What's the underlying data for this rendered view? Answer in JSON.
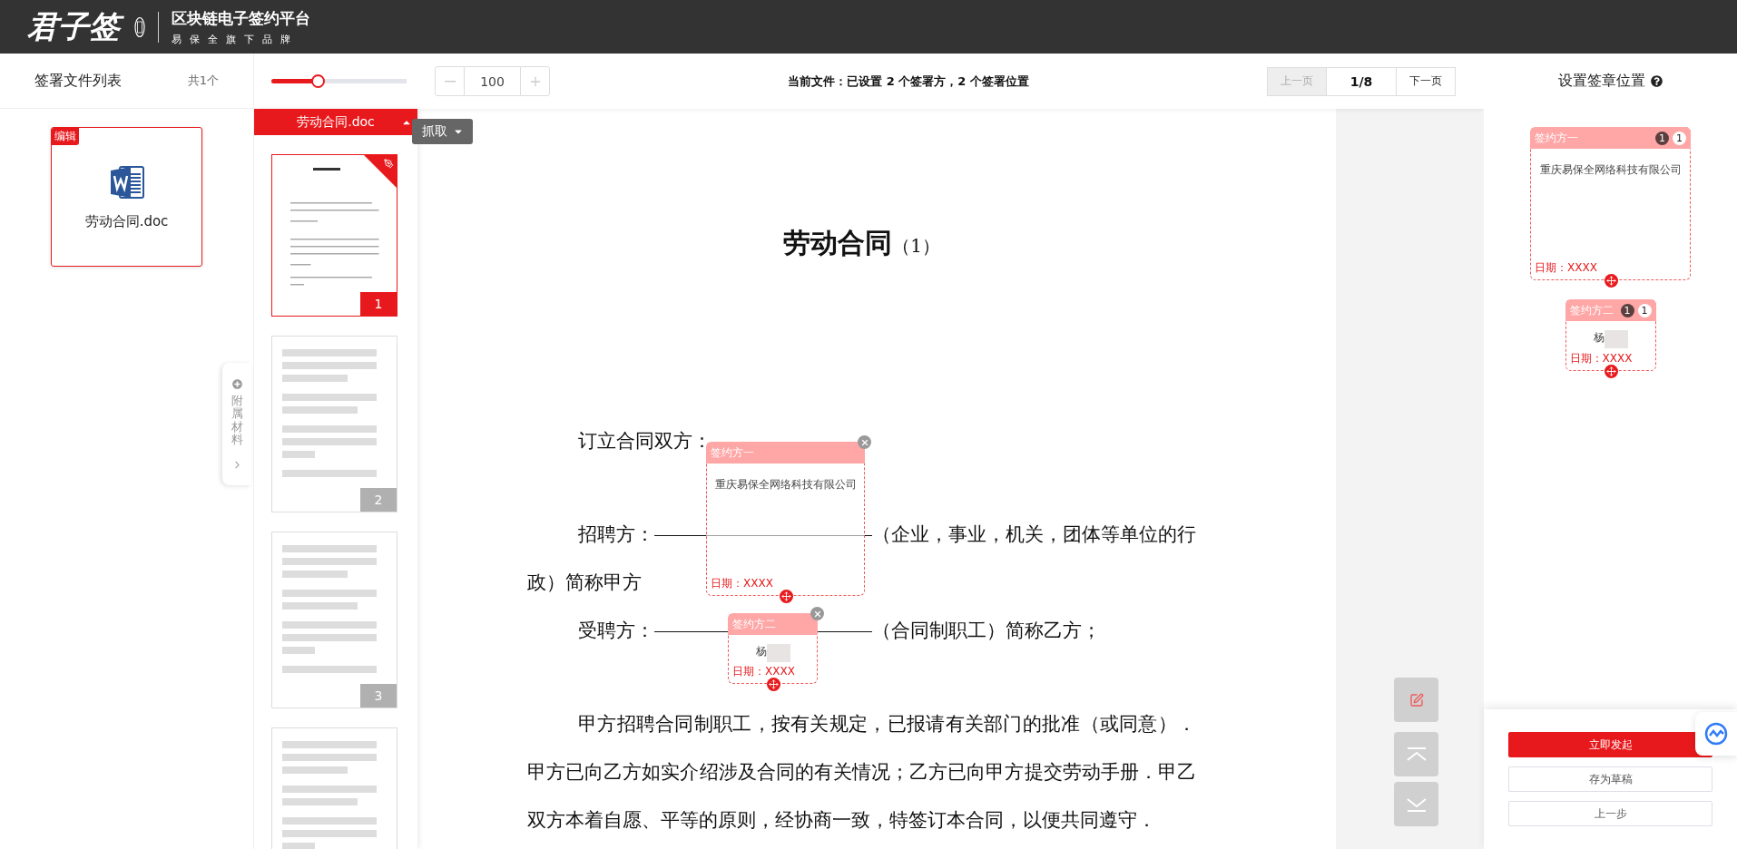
{
  "header": {
    "logo_text": "君子签",
    "platform": "区块链电子签约平台",
    "tagline": "易保全旗下品牌"
  },
  "file_list": {
    "title": "签署文件列表",
    "count": "共1个",
    "files": [
      {
        "name": "劳动合同.doc",
        "badge": "编辑",
        "selected": true
      }
    ]
  },
  "toolbar": {
    "zoom": {
      "level": 0.33,
      "value": "100"
    },
    "status": "当前文件：已设置 2 个签署方，2 个签署位置",
    "pager": {
      "prev": {
        "label": "上一页",
        "disabled": true
      },
      "page": "1/8",
      "next": {
        "label": "下一页",
        "disabled": false
      }
    }
  },
  "thumbnails": {
    "file_name": "劳动合同.doc",
    "grab_button": "抓取",
    "pages": [
      {
        "number": "1",
        "selected": true,
        "kind": "preview"
      },
      {
        "number": "2",
        "selected": false,
        "kind": "placeholder"
      },
      {
        "number": "3",
        "selected": false,
        "kind": "placeholder"
      },
      {
        "selected": false,
        "kind": "placeholder"
      }
    ]
  },
  "attachment_tab": {
    "label": "附属材料"
  },
  "document": {
    "title": "劳动合同",
    "title_suffix": "（1）",
    "paragraphs": [
      [
        {
          "kind": "text",
          "text": "订立合同双方："
        }
      ],
      [
        {
          "kind": "text",
          "text": "招聘方："
        },
        {
          "kind": "blank"
        },
        {
          "kind": "text",
          "text": "（企业，事业，机关，团体等单位的行政）简称甲方"
        }
      ],
      [
        {
          "kind": "text",
          "text": "受聘方："
        },
        {
          "kind": "blank"
        },
        {
          "kind": "text",
          "text": "（合同制职工）简称乙方；"
        }
      ],
      [
        {
          "kind": "text",
          "text": "甲方招聘合同制职工，按有关规定，已报请有关部门的批准（或同意）．甲方已向乙方如实介绍涉及合同的有关情况；乙方已向甲方提交劳动手册．甲乙双方本着自愿、平等的原则，经协商一致，特签订本合同，以便共同遵守．"
        }
      ]
    ],
    "signature_boxes": [
      {
        "title": "签约方一",
        "company": "重庆易保全网络科技有限公司",
        "date": "日期：XXXX",
        "redacted": false
      },
      {
        "title": "签约方二",
        "company": "杨",
        "date": "日期：XXXX",
        "redacted": true
      }
    ]
  },
  "right_panel": {
    "title": "设置签章位置",
    "signers": [
      {
        "title": "签约方一",
        "badges": [
          {
            "text": "1",
            "color": "#5b3f3f"
          },
          {
            "text": "1",
            "color": "#ffffff"
          }
        ],
        "company": "重庆易保全网络科技有限公司",
        "date": "日期：XXXX",
        "redacted": false
      },
      {
        "title": "签约方二",
        "badges": [
          {
            "text": "1",
            "color": "#5b3f3f"
          },
          {
            "text": "1",
            "color": "#ffffff"
          }
        ],
        "company": "杨",
        "date": "日期：XXXX",
        "redacted": true
      }
    ],
    "buttons": [
      {
        "label": "立即发起",
        "kind": "primary"
      },
      {
        "label": "存为草稿",
        "kind": "default"
      },
      {
        "label": "上一步",
        "kind": "default"
      }
    ]
  }
}
